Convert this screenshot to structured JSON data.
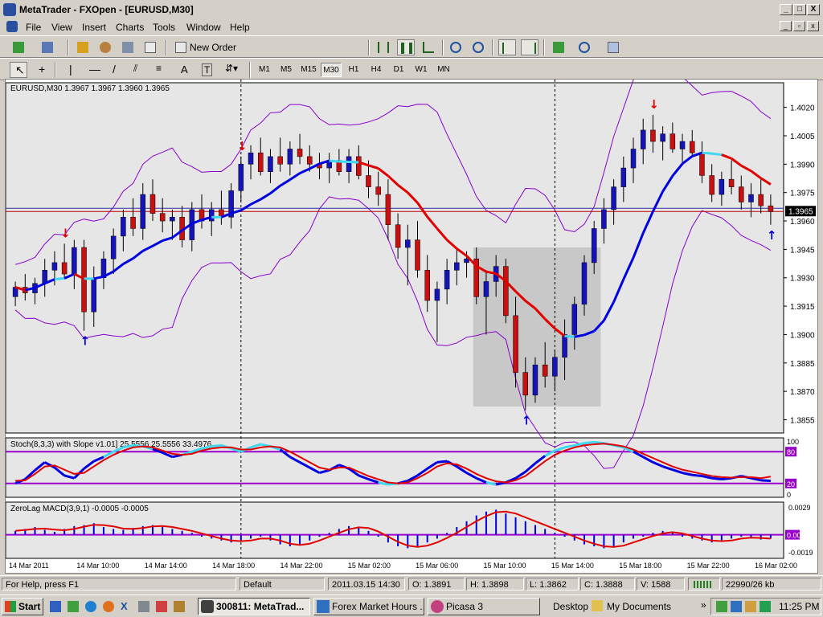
{
  "window": {
    "title": "MetaTrader - FXOpen - [EURUSD,M30]",
    "min_label": "_",
    "max_label": "□",
    "close_label": "X"
  },
  "menu": {
    "items": [
      "File",
      "View",
      "Insert",
      "Charts",
      "Tools",
      "Window",
      "Help"
    ]
  },
  "toolbar": {
    "new_order_label": "New Order"
  },
  "timeframes": {
    "items": [
      "M1",
      "M5",
      "M15",
      "M30",
      "H1",
      "H4",
      "D1",
      "W1",
      "MN"
    ],
    "selected": "M30"
  },
  "chart": {
    "price_title": "EURUSD,M30  1.3967 1.3967 1.3960 1.3965",
    "stoch_title": "Stoch(8,3,3) with Slope v1.01] 25.5556 25.5556 33.4976",
    "macd_title": "ZeroLag MACD(3,9,1) -0.0005 -0.0005",
    "current_price_label": "1.3965",
    "price_ticks": [
      "1.4020",
      "1.4005",
      "1.3990",
      "1.3975",
      "1.3960",
      "1.3945",
      "1.3930",
      "1.3915",
      "1.3900",
      "1.3885",
      "1.3870",
      "1.3855"
    ],
    "stoch_ticks": [
      "100",
      "80",
      "20",
      "0"
    ],
    "macd_ticks": [
      "0.0029",
      "0.00",
      "-0.0019"
    ],
    "time_labels": [
      "14 Mar 2011",
      "14 Mar 10:00",
      "14 Mar 14:00",
      "14 Mar 18:00",
      "14 Mar 22:00",
      "15 Mar 02:00",
      "15 Mar 06:00",
      "15 Mar 10:00",
      "15 Mar 14:00",
      "15 Mar 18:00",
      "15 Mar 22:00",
      "16 Mar 02:00"
    ],
    "colors": {
      "bull": "#1414b8",
      "bear": "#c81010",
      "band": "#8800cc",
      "ma_up": "#0000e0",
      "ma_down": "#e00000",
      "ma_flat": "#40d8f0",
      "hline": "#c00000",
      "level": "#9900cc",
      "grey_box": "#c8c8c8"
    }
  },
  "chart_data": {
    "type": "candlestick",
    "symbol": "EURUSD",
    "timeframe": "M30",
    "ylim": [
      1.3848,
      1.4033
    ],
    "current_price": 1.3965,
    "candles_ohlc": [
      [
        1.392,
        1.3928,
        1.3915,
        1.3925
      ],
      [
        1.3925,
        1.3932,
        1.3918,
        1.3922
      ],
      [
        1.3922,
        1.393,
        1.3916,
        1.3927
      ],
      [
        1.3927,
        1.394,
        1.392,
        1.3934
      ],
      [
        1.3934,
        1.3944,
        1.3926,
        1.3938
      ],
      [
        1.3938,
        1.3948,
        1.393,
        1.3932
      ],
      [
        1.3932,
        1.395,
        1.3924,
        1.3946
      ],
      [
        1.3946,
        1.395,
        1.3902,
        1.3912
      ],
      [
        1.3912,
        1.3936,
        1.3904,
        1.393
      ],
      [
        1.393,
        1.3944,
        1.3924,
        1.394
      ],
      [
        1.394,
        1.3956,
        1.3932,
        1.3952
      ],
      [
        1.3952,
        1.3966,
        1.3944,
        1.3962
      ],
      [
        1.3962,
        1.3972,
        1.3952,
        1.3956
      ],
      [
        1.3956,
        1.398,
        1.395,
        1.3974
      ],
      [
        1.3974,
        1.3982,
        1.396,
        1.3964
      ],
      [
        1.3964,
        1.3972,
        1.3954,
        1.396
      ],
      [
        1.396,
        1.3966,
        1.395,
        1.3962
      ],
      [
        1.3962,
        1.3968,
        1.3946,
        1.395
      ],
      [
        1.395,
        1.397,
        1.3944,
        1.3966
      ],
      [
        1.3966,
        1.3974,
        1.3956,
        1.396
      ],
      [
        1.396,
        1.397,
        1.3952,
        1.3966
      ],
      [
        1.3966,
        1.3976,
        1.3958,
        1.3962
      ],
      [
        1.3962,
        1.398,
        1.3956,
        1.3976
      ],
      [
        1.3976,
        1.3994,
        1.397,
        1.399
      ],
      [
        1.399,
        1.4,
        1.3982,
        1.3996
      ],
      [
        1.3996,
        1.4004,
        1.3984,
        1.3986
      ],
      [
        1.3986,
        1.3998,
        1.398,
        1.3994
      ],
      [
        1.3994,
        1.4004,
        1.3986,
        1.399
      ],
      [
        1.399,
        1.4002,
        1.3984,
        1.3998
      ],
      [
        1.3998,
        1.4006,
        1.399,
        1.3994
      ],
      [
        1.3994,
        1.4,
        1.3986,
        1.399
      ],
      [
        1.399,
        1.3996,
        1.3982,
        1.3988
      ],
      [
        1.3988,
        1.3996,
        1.398,
        1.3992
      ],
      [
        1.3992,
        1.3998,
        1.3984,
        1.3986
      ],
      [
        1.3986,
        1.3998,
        1.398,
        1.3994
      ],
      [
        1.3994,
        1.4,
        1.3982,
        1.3984
      ],
      [
        1.3984,
        1.3992,
        1.3972,
        1.3978
      ],
      [
        1.3978,
        1.3986,
        1.3968,
        1.3974
      ],
      [
        1.3974,
        1.3982,
        1.395,
        1.3958
      ],
      [
        1.3958,
        1.3964,
        1.394,
        1.3946
      ],
      [
        1.3946,
        1.3958,
        1.3926,
        1.395
      ],
      [
        1.395,
        1.396,
        1.393,
        1.3934
      ],
      [
        1.3934,
        1.3942,
        1.3912,
        1.3918
      ],
      [
        1.3918,
        1.3928,
        1.3896,
        1.3924
      ],
      [
        1.3924,
        1.394,
        1.3916,
        1.3934
      ],
      [
        1.3934,
        1.3946,
        1.3926,
        1.3938
      ],
      [
        1.3938,
        1.3944,
        1.393,
        1.394
      ],
      [
        1.394,
        1.3946,
        1.3916,
        1.392
      ],
      [
        1.392,
        1.3934,
        1.39,
        1.3928
      ],
      [
        1.3928,
        1.3942,
        1.392,
        1.3936
      ],
      [
        1.3936,
        1.394,
        1.3906,
        1.391
      ],
      [
        1.391,
        1.392,
        1.3872,
        1.388
      ],
      [
        1.388,
        1.3888,
        1.386,
        1.3868
      ],
      [
        1.3868,
        1.3888,
        1.3864,
        1.3884
      ],
      [
        1.3884,
        1.3896,
        1.3872,
        1.3878
      ],
      [
        1.3878,
        1.3892,
        1.387,
        1.3888
      ],
      [
        1.3888,
        1.3908,
        1.3876,
        1.39
      ],
      [
        1.39,
        1.392,
        1.3892,
        1.3916
      ],
      [
        1.3916,
        1.3942,
        1.391,
        1.3938
      ],
      [
        1.3938,
        1.396,
        1.3932,
        1.3956
      ],
      [
        1.3956,
        1.3972,
        1.3948,
        1.3966
      ],
      [
        1.3966,
        1.3982,
        1.3958,
        1.3978
      ],
      [
        1.3978,
        1.3994,
        1.397,
        1.3988
      ],
      [
        1.3988,
        1.4004,
        1.398,
        1.3998
      ],
      [
        1.3998,
        1.4014,
        1.399,
        1.4008
      ],
      [
        1.4008,
        1.4016,
        1.3996,
        1.4002
      ],
      [
        1.4002,
        1.401,
        1.3992,
        1.4006
      ],
      [
        1.4006,
        1.4012,
        1.3996,
        1.3998
      ],
      [
        1.3998,
        1.4006,
        1.399,
        1.4002
      ],
      [
        1.4002,
        1.4008,
        1.3994,
        1.3996
      ],
      [
        1.3996,
        1.4002,
        1.398,
        1.3984
      ],
      [
        1.3984,
        1.399,
        1.397,
        1.3974
      ],
      [
        1.3974,
        1.3986,
        1.3968,
        1.3982
      ],
      [
        1.3982,
        1.3992,
        1.3974,
        1.3978
      ],
      [
        1.3978,
        1.3984,
        1.3966,
        1.397
      ],
      [
        1.397,
        1.398,
        1.3962,
        1.3974
      ],
      [
        1.3974,
        1.3982,
        1.3964,
        1.3968
      ],
      [
        1.3968,
        1.3974,
        1.3958,
        1.3965
      ]
    ],
    "arrows": [
      {
        "index": 5,
        "dir": "down"
      },
      {
        "index": 7,
        "dir": "up"
      },
      {
        "index": 23,
        "dir": "down"
      },
      {
        "index": 52,
        "dir": "up"
      },
      {
        "index": 65,
        "dir": "down"
      },
      {
        "index": 77,
        "dir": "up"
      }
    ],
    "stoch": {
      "levels": [
        20,
        80
      ],
      "main": [
        20,
        28,
        45,
        60,
        50,
        35,
        30,
        48,
        62,
        70,
        80,
        88,
        92,
        90,
        85,
        78,
        70,
        74,
        80,
        86,
        90,
        92,
        86,
        80,
        88,
        94,
        90,
        84,
        70,
        60,
        50,
        40,
        45,
        55,
        48,
        35,
        28,
        22,
        18,
        20,
        25,
        35,
        48,
        60,
        62,
        52,
        40,
        30,
        22,
        18,
        22,
        30,
        42,
        58,
        72,
        82,
        88,
        92,
        96,
        98,
        96,
        92,
        88,
        80,
        70,
        60,
        52,
        46,
        40,
        36,
        34,
        30,
        28,
        30,
        34,
        30,
        26,
        25
      ],
      "signal": [
        25,
        26,
        38,
        52,
        54,
        46,
        38,
        40,
        52,
        64,
        74,
        82,
        88,
        90,
        88,
        82,
        76,
        74,
        76,
        82,
        86,
        88,
        88,
        84,
        84,
        88,
        90,
        88,
        80,
        70,
        60,
        50,
        46,
        50,
        50,
        42,
        34,
        28,
        22,
        20,
        22,
        30,
        40,
        52,
        58,
        56,
        48,
        38,
        30,
        24,
        22,
        26,
        34,
        48,
        62,
        74,
        82,
        88,
        92,
        94,
        95,
        93,
        90,
        84,
        76,
        68,
        60,
        52,
        46,
        42,
        38,
        34,
        32,
        31,
        32,
        32,
        30,
        33
      ]
    },
    "macd": {
      "hist": [
        4,
        6,
        8,
        5,
        3,
        6,
        9,
        10,
        12,
        8,
        6,
        5,
        7,
        9,
        10,
        8,
        6,
        4,
        2,
        -2,
        -4,
        -6,
        -8,
        -6,
        -4,
        -2,
        -6,
        -10,
        -12,
        -10,
        -6,
        -2,
        2,
        6,
        9,
        8,
        4,
        -2,
        -8,
        -12,
        -14,
        -12,
        -8,
        -4,
        2,
        8,
        14,
        20,
        24,
        26,
        22,
        18,
        14,
        10,
        6,
        2,
        -2,
        -6,
        -10,
        -12,
        -14,
        -12,
        -8,
        -4,
        -2,
        2,
        4,
        2,
        -2,
        -4,
        -6,
        -8,
        -6,
        -4,
        -2,
        -3,
        -5,
        -4
      ]
    }
  },
  "status": {
    "help": "For Help, press F1",
    "profile": "Default",
    "datetime": "2011.03.15 14:30",
    "open": "O: 1.3891",
    "high": "H: 1.3898",
    "low": "L: 1.3862",
    "close": "C: 1.3888",
    "volume": "V: 1588",
    "traffic": "22990/26 kb"
  },
  "taskbar": {
    "start_label": "Start",
    "task_metatrader": "300811: MetaTrad...",
    "task_forex": "Forex Market Hours ...",
    "task_picasa": "Picasa 3",
    "desktop_label": "Desktop",
    "mydocs_label": "My Documents",
    "clock": "11:25 PM"
  }
}
